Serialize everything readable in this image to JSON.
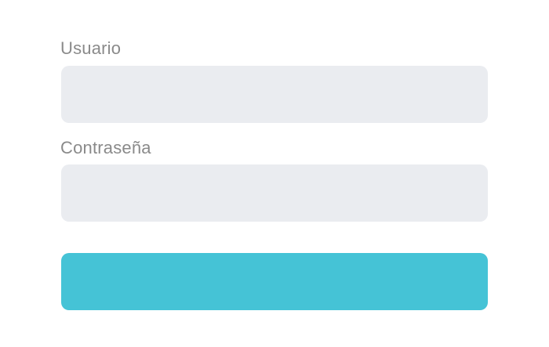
{
  "form": {
    "username": {
      "label": "Usuario",
      "value": "",
      "placeholder": ""
    },
    "password": {
      "label": "Contraseña",
      "value": "",
      "placeholder": ""
    },
    "submit": {
      "label": ""
    }
  },
  "colors": {
    "label_text": "#8a8a8a",
    "input_background": "#eaecf0",
    "button_background": "#45c3d6",
    "page_background": "#ffffff"
  }
}
